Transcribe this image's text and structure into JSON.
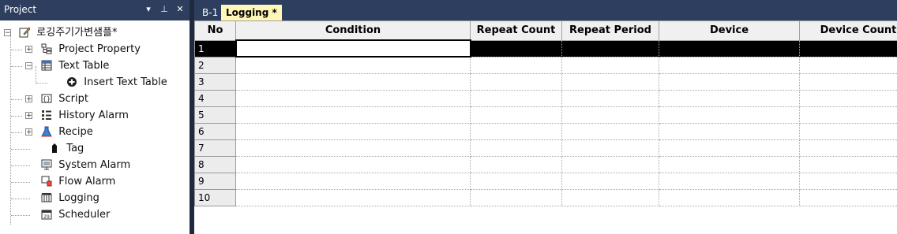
{
  "project_panel": {
    "title": "Project",
    "dropdown_glyph": "▾",
    "pin_glyph": "⊥",
    "close_glyph": "✕",
    "tree": {
      "root_label": "로깅주기가변샘플*",
      "items": [
        {
          "label": "Project Property",
          "icon": "project-property-icon"
        },
        {
          "label": "Text Table",
          "icon": "text-table-icon"
        },
        {
          "label": "Insert Text Table",
          "icon": "insert-plus-icon"
        },
        {
          "label": "Script",
          "icon": "script-icon"
        },
        {
          "label": "History Alarm",
          "icon": "history-alarm-icon"
        },
        {
          "label": "Recipe",
          "icon": "recipe-flask-icon"
        },
        {
          "label": "Tag",
          "icon": "tag-icon"
        },
        {
          "label": "System Alarm",
          "icon": "system-alarm-icon"
        },
        {
          "label": "Flow Alarm",
          "icon": "flow-alarm-icon"
        },
        {
          "label": "Logging",
          "icon": "logging-icon"
        },
        {
          "label": "Scheduler",
          "icon": "scheduler-calendar-icon"
        }
      ]
    }
  },
  "tabs": [
    {
      "label": "B-1"
    },
    {
      "label": "Logging *"
    }
  ],
  "grid": {
    "columns": [
      "No",
      "Condition",
      "Repeat Count",
      "Repeat Period",
      "Device",
      "Device Count"
    ],
    "rows": [
      "1",
      "2",
      "3",
      "4",
      "5",
      "6",
      "7",
      "8",
      "9",
      "10"
    ],
    "selected_row": "1"
  },
  "colors": {
    "header_bg": "#2d3e5e",
    "active_tab_bg": "#fff6b8",
    "selected_row_bg": "#000000"
  }
}
